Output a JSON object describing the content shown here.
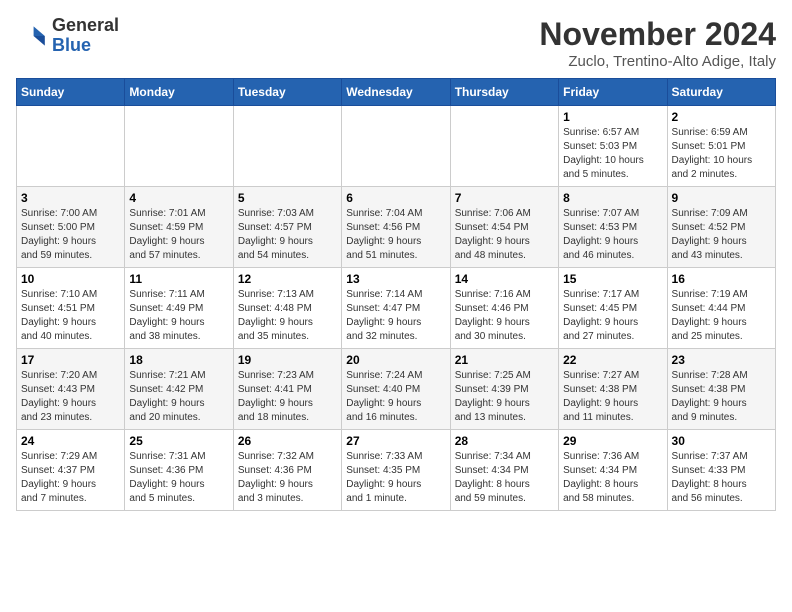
{
  "header": {
    "logo_line1": "General",
    "logo_line2": "Blue",
    "month_title": "November 2024",
    "subtitle": "Zuclo, Trentino-Alto Adige, Italy"
  },
  "weekdays": [
    "Sunday",
    "Monday",
    "Tuesday",
    "Wednesday",
    "Thursday",
    "Friday",
    "Saturday"
  ],
  "weeks": [
    [
      {
        "day": "",
        "info": ""
      },
      {
        "day": "",
        "info": ""
      },
      {
        "day": "",
        "info": ""
      },
      {
        "day": "",
        "info": ""
      },
      {
        "day": "",
        "info": ""
      },
      {
        "day": "1",
        "info": "Sunrise: 6:57 AM\nSunset: 5:03 PM\nDaylight: 10 hours\nand 5 minutes."
      },
      {
        "day": "2",
        "info": "Sunrise: 6:59 AM\nSunset: 5:01 PM\nDaylight: 10 hours\nand 2 minutes."
      }
    ],
    [
      {
        "day": "3",
        "info": "Sunrise: 7:00 AM\nSunset: 5:00 PM\nDaylight: 9 hours\nand 59 minutes."
      },
      {
        "day": "4",
        "info": "Sunrise: 7:01 AM\nSunset: 4:59 PM\nDaylight: 9 hours\nand 57 minutes."
      },
      {
        "day": "5",
        "info": "Sunrise: 7:03 AM\nSunset: 4:57 PM\nDaylight: 9 hours\nand 54 minutes."
      },
      {
        "day": "6",
        "info": "Sunrise: 7:04 AM\nSunset: 4:56 PM\nDaylight: 9 hours\nand 51 minutes."
      },
      {
        "day": "7",
        "info": "Sunrise: 7:06 AM\nSunset: 4:54 PM\nDaylight: 9 hours\nand 48 minutes."
      },
      {
        "day": "8",
        "info": "Sunrise: 7:07 AM\nSunset: 4:53 PM\nDaylight: 9 hours\nand 46 minutes."
      },
      {
        "day": "9",
        "info": "Sunrise: 7:09 AM\nSunset: 4:52 PM\nDaylight: 9 hours\nand 43 minutes."
      }
    ],
    [
      {
        "day": "10",
        "info": "Sunrise: 7:10 AM\nSunset: 4:51 PM\nDaylight: 9 hours\nand 40 minutes."
      },
      {
        "day": "11",
        "info": "Sunrise: 7:11 AM\nSunset: 4:49 PM\nDaylight: 9 hours\nand 38 minutes."
      },
      {
        "day": "12",
        "info": "Sunrise: 7:13 AM\nSunset: 4:48 PM\nDaylight: 9 hours\nand 35 minutes."
      },
      {
        "day": "13",
        "info": "Sunrise: 7:14 AM\nSunset: 4:47 PM\nDaylight: 9 hours\nand 32 minutes."
      },
      {
        "day": "14",
        "info": "Sunrise: 7:16 AM\nSunset: 4:46 PM\nDaylight: 9 hours\nand 30 minutes."
      },
      {
        "day": "15",
        "info": "Sunrise: 7:17 AM\nSunset: 4:45 PM\nDaylight: 9 hours\nand 27 minutes."
      },
      {
        "day": "16",
        "info": "Sunrise: 7:19 AM\nSunset: 4:44 PM\nDaylight: 9 hours\nand 25 minutes."
      }
    ],
    [
      {
        "day": "17",
        "info": "Sunrise: 7:20 AM\nSunset: 4:43 PM\nDaylight: 9 hours\nand 23 minutes."
      },
      {
        "day": "18",
        "info": "Sunrise: 7:21 AM\nSunset: 4:42 PM\nDaylight: 9 hours\nand 20 minutes."
      },
      {
        "day": "19",
        "info": "Sunrise: 7:23 AM\nSunset: 4:41 PM\nDaylight: 9 hours\nand 18 minutes."
      },
      {
        "day": "20",
        "info": "Sunrise: 7:24 AM\nSunset: 4:40 PM\nDaylight: 9 hours\nand 16 minutes."
      },
      {
        "day": "21",
        "info": "Sunrise: 7:25 AM\nSunset: 4:39 PM\nDaylight: 9 hours\nand 13 minutes."
      },
      {
        "day": "22",
        "info": "Sunrise: 7:27 AM\nSunset: 4:38 PM\nDaylight: 9 hours\nand 11 minutes."
      },
      {
        "day": "23",
        "info": "Sunrise: 7:28 AM\nSunset: 4:38 PM\nDaylight: 9 hours\nand 9 minutes."
      }
    ],
    [
      {
        "day": "24",
        "info": "Sunrise: 7:29 AM\nSunset: 4:37 PM\nDaylight: 9 hours\nand 7 minutes."
      },
      {
        "day": "25",
        "info": "Sunrise: 7:31 AM\nSunset: 4:36 PM\nDaylight: 9 hours\nand 5 minutes."
      },
      {
        "day": "26",
        "info": "Sunrise: 7:32 AM\nSunset: 4:36 PM\nDaylight: 9 hours\nand 3 minutes."
      },
      {
        "day": "27",
        "info": "Sunrise: 7:33 AM\nSunset: 4:35 PM\nDaylight: 9 hours\nand 1 minute."
      },
      {
        "day": "28",
        "info": "Sunrise: 7:34 AM\nSunset: 4:34 PM\nDaylight: 8 hours\nand 59 minutes."
      },
      {
        "day": "29",
        "info": "Sunrise: 7:36 AM\nSunset: 4:34 PM\nDaylight: 8 hours\nand 58 minutes."
      },
      {
        "day": "30",
        "info": "Sunrise: 7:37 AM\nSunset: 4:33 PM\nDaylight: 8 hours\nand 56 minutes."
      }
    ]
  ]
}
